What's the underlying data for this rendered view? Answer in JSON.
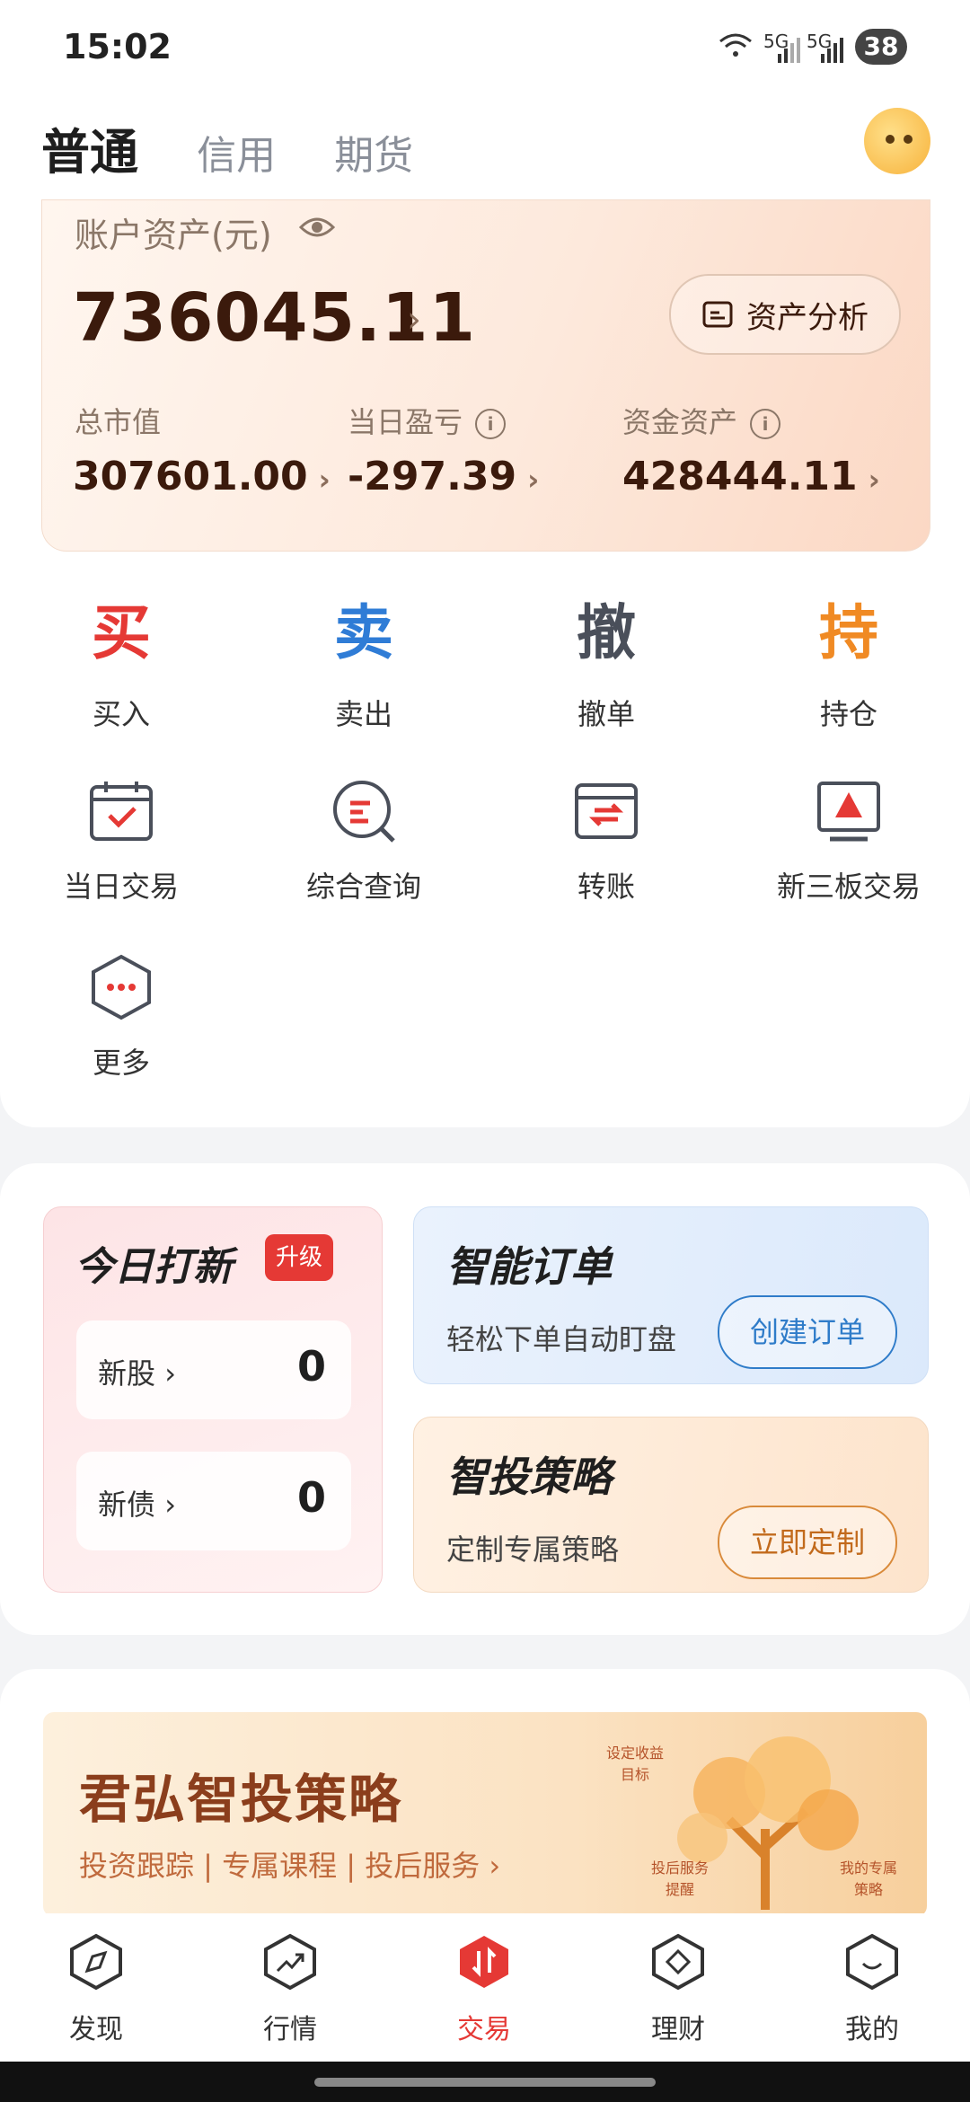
{
  "status_bar": {
    "time": "15:02",
    "signal1": "5G",
    "signal2": "5G",
    "battery": "38"
  },
  "header": {
    "tabs": [
      {
        "label": "普通",
        "active": true
      },
      {
        "label": "信用",
        "active": false
      },
      {
        "label": "期货",
        "active": false
      }
    ]
  },
  "assets": {
    "label": "账户资产(元)",
    "total": "736045.11",
    "analysis_label": "资产分析",
    "market_value_label": "总市值",
    "market_value": "307601.00",
    "daily_pl_label": "当日盈亏",
    "daily_pl": "-297.39",
    "fund_label": "资金资产",
    "fund": "428444.11"
  },
  "actions": [
    {
      "char": "买",
      "label": "买入",
      "color": "#e53935"
    },
    {
      "char": "卖",
      "label": "卖出",
      "color": "#2f7cd6"
    },
    {
      "char": "撤",
      "label": "撤单",
      "color": "#4a4f5a"
    },
    {
      "char": "持",
      "label": "持仓",
      "color": "#f08a24"
    }
  ],
  "tools": [
    {
      "label": "当日交易",
      "icon": "calendar-check-icon"
    },
    {
      "label": "综合查询",
      "icon": "search-query-icon"
    },
    {
      "label": "转账",
      "icon": "transfer-icon"
    },
    {
      "label": "新三板交易",
      "icon": "monitor-icon"
    },
    {
      "label": "更多",
      "icon": "more-hexagon-icon"
    }
  ],
  "ipo": {
    "title": "今日打新",
    "badge": "升级",
    "stock_label": "新股",
    "stock_count": "0",
    "bond_label": "新债",
    "bond_count": "0"
  },
  "smart_order": {
    "title": "智能订单",
    "subtitle": "轻松下单自动盯盘",
    "button": "创建订单"
  },
  "strategy": {
    "title": "智投策略",
    "subtitle": "定制专属策略",
    "button": "立即定制"
  },
  "banner": {
    "title": "君弘智投策略",
    "subtitle": "投资跟踪 | 专属课程 | 投后服务 ›",
    "tree_labels": [
      "设定收益目标",
      "投后服务提醒",
      "我的专属策略"
    ]
  },
  "nav": [
    {
      "label": "发现",
      "active": false,
      "icon": "compass-icon"
    },
    {
      "label": "行情",
      "active": false,
      "icon": "trend-icon"
    },
    {
      "label": "交易",
      "active": true,
      "icon": "trade-icon"
    },
    {
      "label": "理财",
      "active": false,
      "icon": "wealth-icon"
    },
    {
      "label": "我的",
      "active": false,
      "icon": "profile-icon"
    }
  ]
}
